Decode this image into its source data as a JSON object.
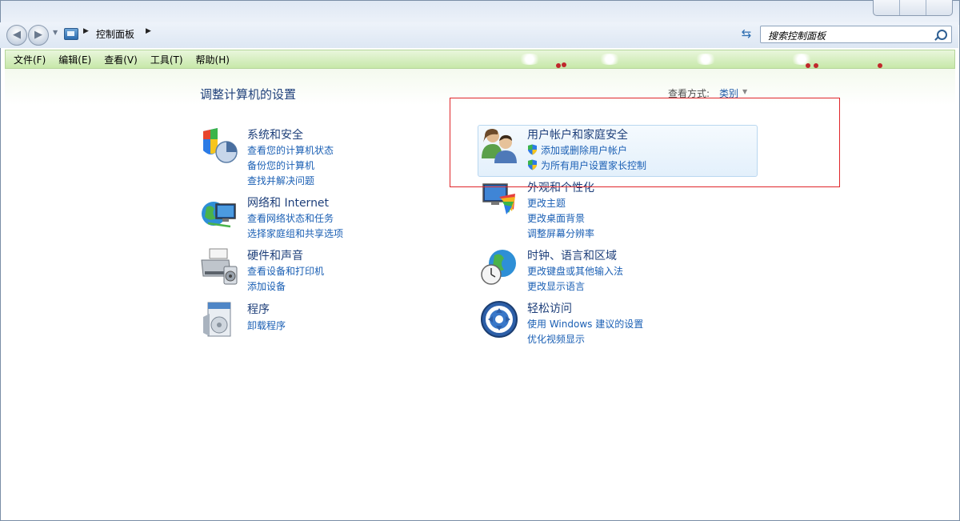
{
  "address": {
    "crumb": "控制面板",
    "search_placeholder": "搜索控制面板"
  },
  "menu": {
    "items": [
      "文件(F)",
      "编辑(E)",
      "查看(V)",
      "工具(T)",
      "帮助(H)"
    ]
  },
  "page": {
    "title": "调整计算机的设置",
    "view_label": "查看方式:",
    "view_value": "类别"
  },
  "categories": [
    {
      "title": "系统和安全",
      "links": [
        "查看您的计算机状态",
        "备份您的计算机",
        "查找并解决问题"
      ],
      "icon": "system-security-icon"
    },
    {
      "title": "网络和 Internet",
      "links": [
        "查看网络状态和任务",
        "选择家庭组和共享选项"
      ],
      "icon": "network-icon"
    },
    {
      "title": "硬件和声音",
      "links": [
        "查看设备和打印机",
        "添加设备"
      ],
      "icon": "hardware-sound-icon"
    },
    {
      "title": "程序",
      "links": [
        "卸载程序"
      ],
      "icon": "programs-icon"
    },
    {
      "title": "用户帐户和家庭安全",
      "links": [
        "添加或删除用户帐户",
        "为所有用户设置家长控制"
      ],
      "icon": "user-accounts-icon"
    },
    {
      "title": "外观和个性化",
      "links": [
        "更改主题",
        "更改桌面背景",
        "调整屏幕分辨率"
      ],
      "icon": "appearance-icon"
    },
    {
      "title": "时钟、语言和区域",
      "links": [
        "更改键盘或其他输入法",
        "更改显示语言"
      ],
      "icon": "clock-language-icon"
    },
    {
      "title": "轻松访问",
      "links": [
        "使用 Windows 建议的设置",
        "优化视频显示"
      ],
      "icon": "ease-of-access-icon"
    }
  ],
  "colors": {
    "highlight_border": "#e0262a",
    "link": "#1a5fb4",
    "menu_bar": "#c7e8a9"
  }
}
